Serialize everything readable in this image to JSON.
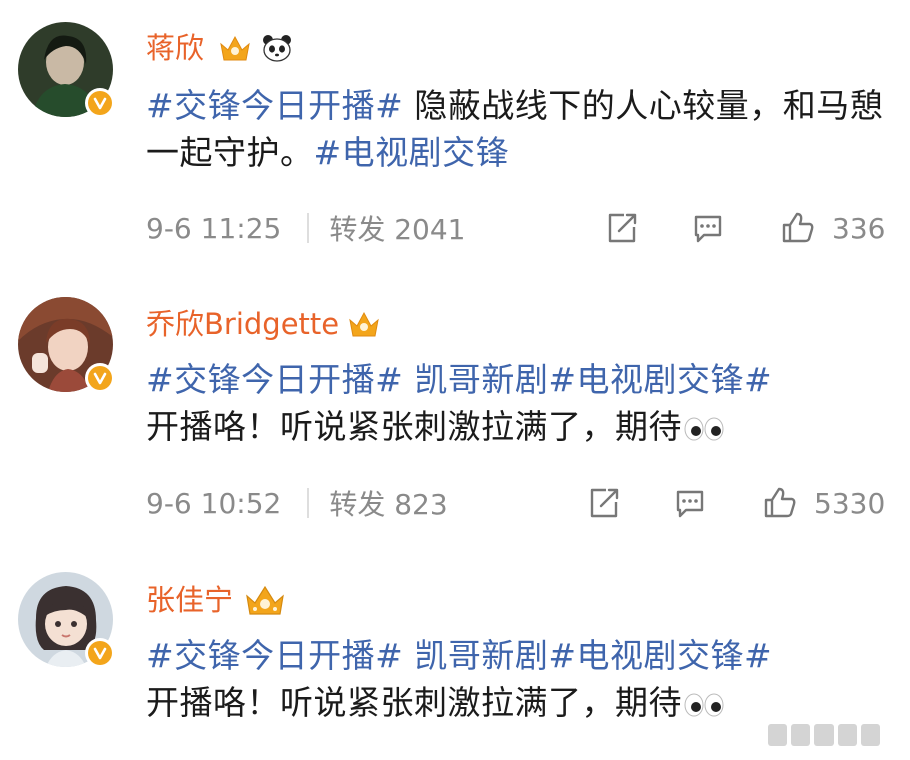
{
  "posts": [
    {
      "name": "蒋欣",
      "text_parts": [
        "#交锋今日开播#",
        " 隐蔽战线下的人心较量，和马憩一起守护。",
        "#电视剧交锋"
      ],
      "time": "9-6 11:25",
      "repost": "转发 2041",
      "likes": "336",
      "avatar_colors": [
        "#2f3c2a",
        "#c9b9a5",
        "#264c2c"
      ]
    },
    {
      "name": "乔欣Bridgette",
      "text_parts": [
        "#交锋今日开播#",
        " ",
        "凯哥新剧",
        "#电视剧交锋#",
        "开播咯！听说紧张刺激拉满了，期待"
      ],
      "time": "9-6 10:52",
      "repost": "转发 823",
      "likes": "5330",
      "avatar_colors": [
        "#6b3b2b",
        "#f1d3c2",
        "#9b4a3a"
      ]
    },
    {
      "name": "张佳宁",
      "text_parts": [
        "#交锋今日开播#",
        " ",
        "凯哥新剧",
        "#电视剧交锋#",
        "开播咯！听说紧张刺激拉满了，期待"
      ],
      "avatar_colors": [
        "#cfd8e0",
        "#f4e0d3",
        "#3a3030"
      ]
    }
  ],
  "colors": {
    "name": "#e8632a",
    "hashtag": "#3f65ac",
    "meta": "#8a8a8a",
    "verified": "#f3a51b"
  },
  "icons": {
    "crown": "crown-badge-icon",
    "panda": "panda-badge-icon",
    "share": "share-icon",
    "comment": "comment-icon",
    "like": "like-icon",
    "eyes": "eyes-emoji-icon"
  }
}
